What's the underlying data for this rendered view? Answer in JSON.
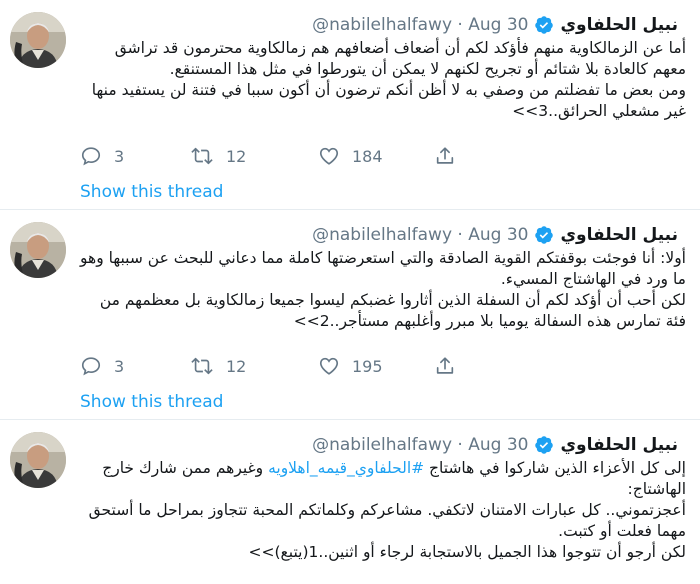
{
  "tweets": [
    {
      "name": "نبيل الحلفاوي",
      "handle": "@nabilelhalfawy",
      "date": "· Aug 30",
      "body": [
        "أما عن الزمالكاوية منهم فأؤكد لكم أن أضعاف أضعافهم هم زمالكاوية محترمون قد تراشق معهم كالعادة بلا شتائم أو تجريح لكنهم لا يمكن أن يتورطوا في مثل هذا المستنقع.",
        "ومن بعض ما تفضلتم من وصفي به لا أظن أنكم ترضون أن أكون سببا في فتنة لن يستفيد منها غير مشعلي الحرائق..3>>"
      ],
      "replies": "3",
      "retweets": "12",
      "likes": "184",
      "thread_link": "Show this thread"
    },
    {
      "name": "نبيل الحلفاوي",
      "handle": "@nabilelhalfawy",
      "date": "· Aug 30",
      "body": [
        "أولا: أنا فوجئت بوقفتكم القوية الصادقة والتي استعرضتها كاملة مما دعاني للبحث عن سببها وهو ما ورد في الهاشتاج المسيء.",
        "لكن أحب أن أؤكد لكم أن السفلة الذين أثاروا غضبكم ليسوا جميعا زمالكاوية بل معظمهم من فئة تمارس هذه السفالة يوميا بلا مبرر وأغلبهم مستأجر..2>>"
      ],
      "replies": "3",
      "retweets": "12",
      "likes": "195",
      "thread_link": "Show this thread"
    },
    {
      "name": "نبيل الحلفاوي",
      "handle": "@nabilelhalfawy",
      "date": "· Aug 30",
      "body_prefix": "إلى كل الأعزاء الذين شاركوا في هاشتاج ",
      "hashtag": "#الحلفاوي_قيمه_اهلاويه",
      "body_suffix": " وغيرهم ممن شارك خارج الهاشتاج:",
      "body_rest": [
        "أعجزتموني.. كل عبارات الامتنان لاتكفي. مشاعركم وكلماتكم المحبة تتجاوز بمراحل ما أستحق مهما فعلت أو كتبت.",
        "لكن أرجو أن تتوجوا هذا الجميل بالاستجابة لرجاء أو اثنين..1(يتبع)>>"
      ]
    }
  ],
  "colors": {
    "accent": "#1da1f2",
    "muted": "#657786",
    "text": "#14171a",
    "divider": "#e6ecf0"
  },
  "icons": [
    "avatar",
    "verified-badge-icon",
    "reply-icon",
    "retweet-icon",
    "like-icon",
    "share-icon"
  ]
}
